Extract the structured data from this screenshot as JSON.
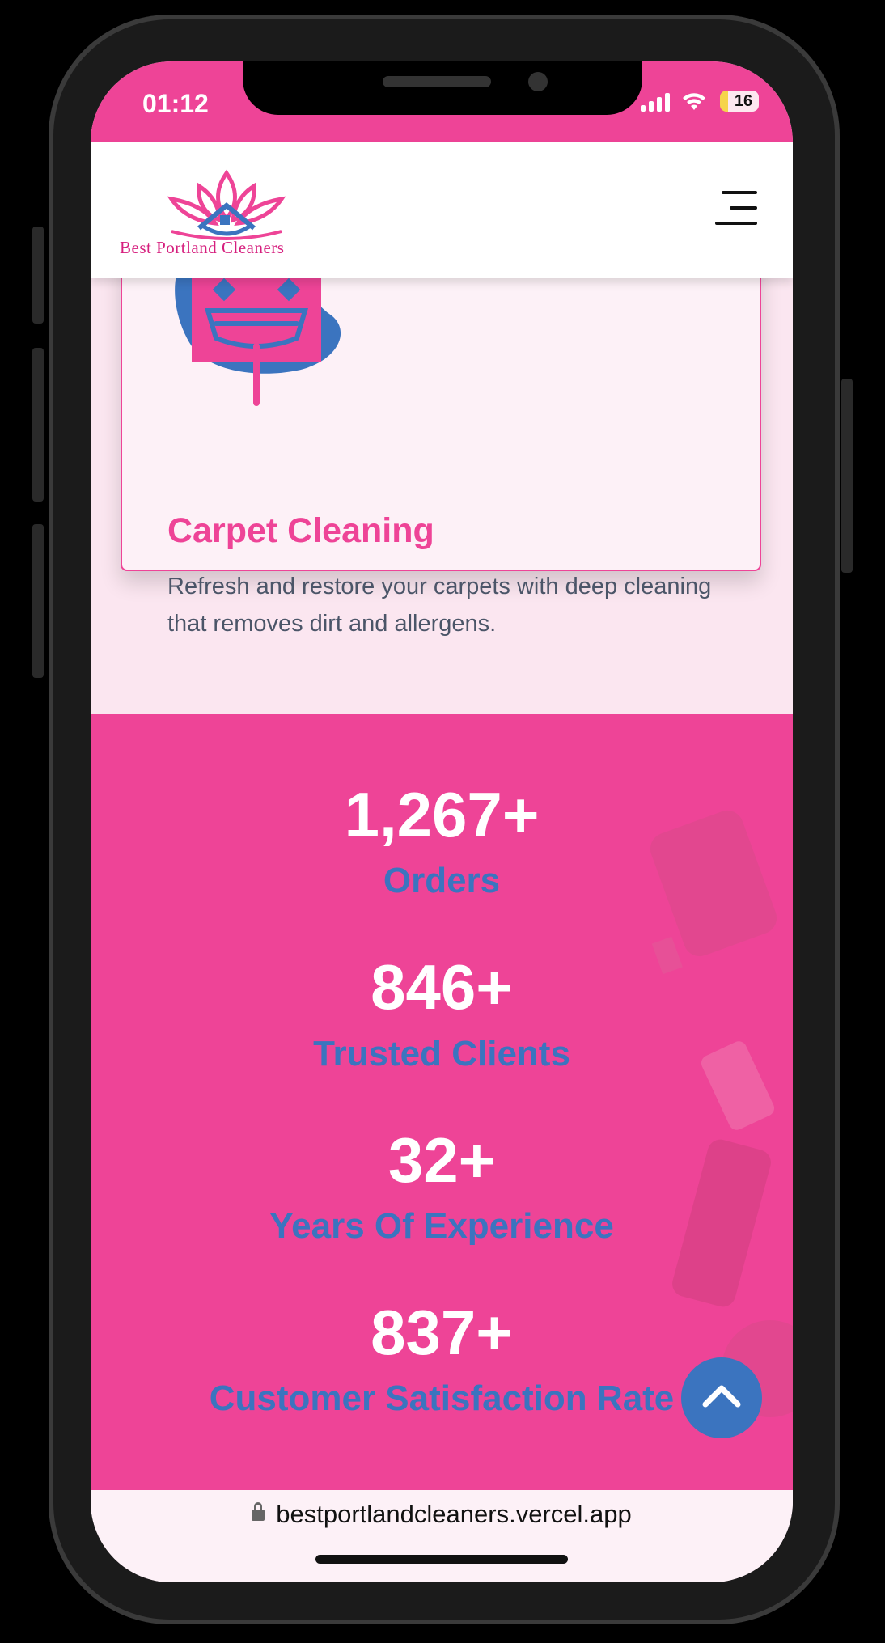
{
  "status_bar": {
    "time": "01:12",
    "battery": "16"
  },
  "header": {
    "brand_name": "Best Portland Cleaners",
    "logo_icon": "lotus-house-logo",
    "menu_icon": "hamburger-menu-icon"
  },
  "service_card": {
    "icon": "squeegee-sparkle-icon",
    "title": "Carpet Cleaning",
    "description": "Refresh and restore your carpets with deep cleaning that removes dirt and allergens."
  },
  "stats": [
    {
      "value": "1,267+",
      "label": "Orders"
    },
    {
      "value": "846+",
      "label": "Trusted Clients"
    },
    {
      "value": "32+",
      "label": "Years Of Experience"
    },
    {
      "value": "837+",
      "label": "Customer Satisfaction Rate"
    }
  ],
  "scroll_top_icon": "chevron-up-icon",
  "browser": {
    "url": "bestportlandcleaners.vercel.app"
  },
  "colors": {
    "brand_pink": "#ee4497",
    "brand_blue": "#3b74bf",
    "text_gray": "#4b5568"
  }
}
